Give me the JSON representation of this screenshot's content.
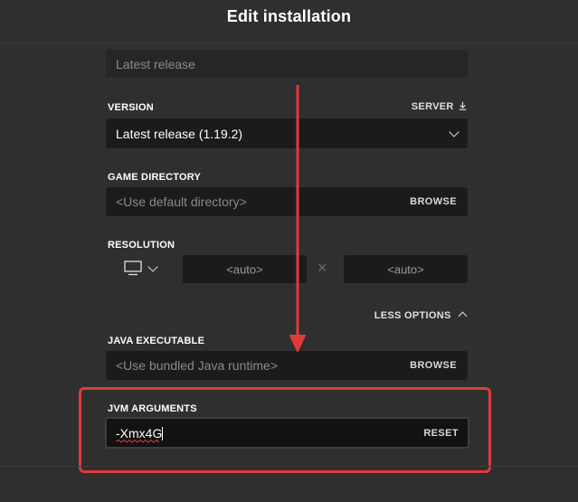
{
  "header": {
    "title": "Edit installation"
  },
  "name": {
    "placeholder": "Latest release"
  },
  "version": {
    "label": "VERSION",
    "server_link": "SERVER",
    "selected": "Latest release (1.19.2)"
  },
  "game_directory": {
    "label": "GAME DIRECTORY",
    "placeholder": "<Use default directory>",
    "browse": "BROWSE"
  },
  "resolution": {
    "label": "RESOLUTION",
    "width": "<auto>",
    "height": "<auto>",
    "separator": "×"
  },
  "options_toggle": "LESS OPTIONS",
  "java_executable": {
    "label": "JAVA EXECUTABLE",
    "placeholder": "<Use bundled Java runtime>",
    "browse": "BROWSE"
  },
  "jvm_arguments": {
    "label": "JVM ARGUMENTS",
    "value": "-Xmx4G",
    "reset": "RESET"
  },
  "colors": {
    "background": "#2f2f2f",
    "field": "#1b1b1b",
    "annotation_red": "#e03a3a"
  }
}
